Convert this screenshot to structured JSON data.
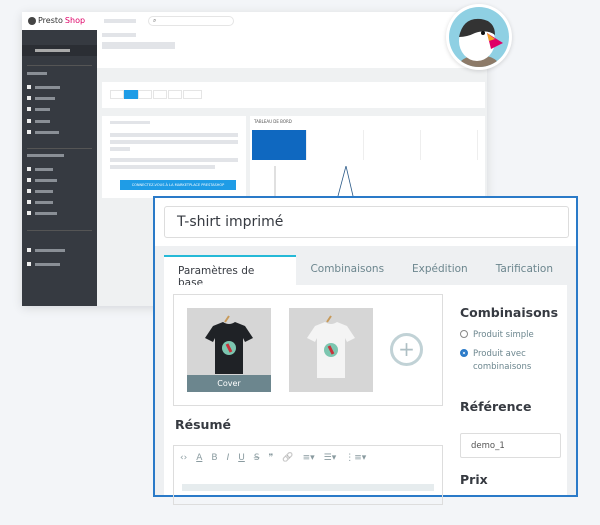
{
  "backoffice": {
    "logo_text": "Presto",
    "logo_brand": "Shop",
    "dashboard_label": "TABLEAU DE BORD",
    "connect_button": "CONNECTEZ-VOUS À LA MARKETPLACE PRESTASHOP",
    "search_icon": "search-icon"
  },
  "product": {
    "title": "T-shirt imprimé",
    "tabs": [
      {
        "label": "Paramètres de base",
        "active": true
      },
      {
        "label": "Combinaisons"
      },
      {
        "label": "Expédition"
      },
      {
        "label": "Tarification"
      }
    ],
    "cover_label": "Cover",
    "add_image_label": "+",
    "combinations_heading": "Combinaisons",
    "option_simple": "Produit simple",
    "option_combinations_1": "Produit avec",
    "option_combinations_2": "combinaisons",
    "selected_option": "Produit avec combinaisons",
    "reference_heading": "Référence",
    "reference_value": "demo_1",
    "summary_heading": "Résumé",
    "price_heading": "Prix",
    "toolbar": [
      "‹›",
      "A",
      "B",
      "I",
      "U",
      "S̶",
      "❞",
      "🔗",
      "≡▾",
      "☰▾",
      "⋮≡▾"
    ]
  },
  "colors": {
    "accent": "#25b9d7",
    "border": "#2a7ac8",
    "sidebar": "#363a41",
    "brand": "#df0067"
  }
}
